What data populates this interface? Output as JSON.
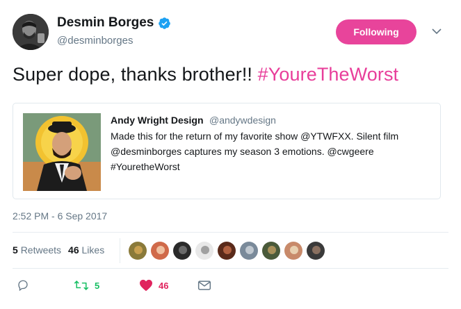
{
  "author": {
    "display_name": "Desmin Borges",
    "handle": "@desminborges",
    "verified": true
  },
  "follow_button": {
    "label": "Following"
  },
  "tweet": {
    "text": "Super dope, thanks brother!!",
    "hashtag": "#YoureTheWorst"
  },
  "quoted": {
    "name": "Andy Wright Design",
    "handle": "@andywdesign",
    "text": "Made this for the return of my favorite show @YTWFXX. Silent film @desminborges captures my season 3 emotions. @cwgeere #YouretheWorst"
  },
  "timestamp": "2:52 PM - 6 Sep 2017",
  "stats": {
    "retweets_count": "5",
    "retweets_label": "Retweets",
    "likes_count": "46",
    "likes_label": "Likes"
  },
  "actions": {
    "reply_count": "",
    "retweet_count": "5",
    "like_count": "46"
  },
  "colors": {
    "follow_bg": "#e8449b",
    "hashtag": "#e83e9a",
    "retweet": "#17bf63",
    "like": "#e0245e",
    "muted": "#657786"
  },
  "icons": [
    "verified-icon",
    "chevron-down-icon",
    "reply-icon",
    "retweet-icon",
    "heart-icon",
    "mail-icon"
  ]
}
